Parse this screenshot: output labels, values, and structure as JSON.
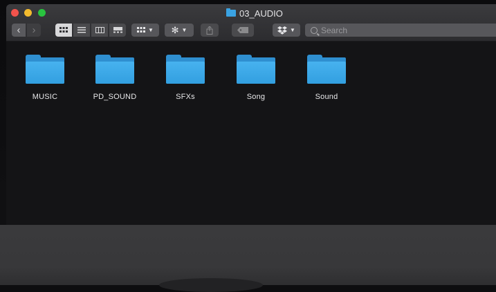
{
  "window": {
    "title": "03_AUDIO"
  },
  "toolbar": {
    "back_icon": "‹",
    "forward_icon": "›",
    "view_modes": [
      "icon-view",
      "list-view",
      "column-view",
      "gallery-view"
    ],
    "arrange_icon": "grid",
    "action_icon": "gear",
    "share_icon": "share",
    "tag_icon": "tag",
    "dropbox_icon": "dropbox",
    "search_placeholder": "Search"
  },
  "folders": [
    {
      "name": "MUSIC"
    },
    {
      "name": "PD_SOUND"
    },
    {
      "name": "SFXs"
    },
    {
      "name": "Song"
    },
    {
      "name": "Sound"
    }
  ],
  "colors": {
    "folder": "#3aa3e3",
    "close": "#f2534c",
    "minimize": "#f3bb2e",
    "maximize": "#29c33f"
  }
}
